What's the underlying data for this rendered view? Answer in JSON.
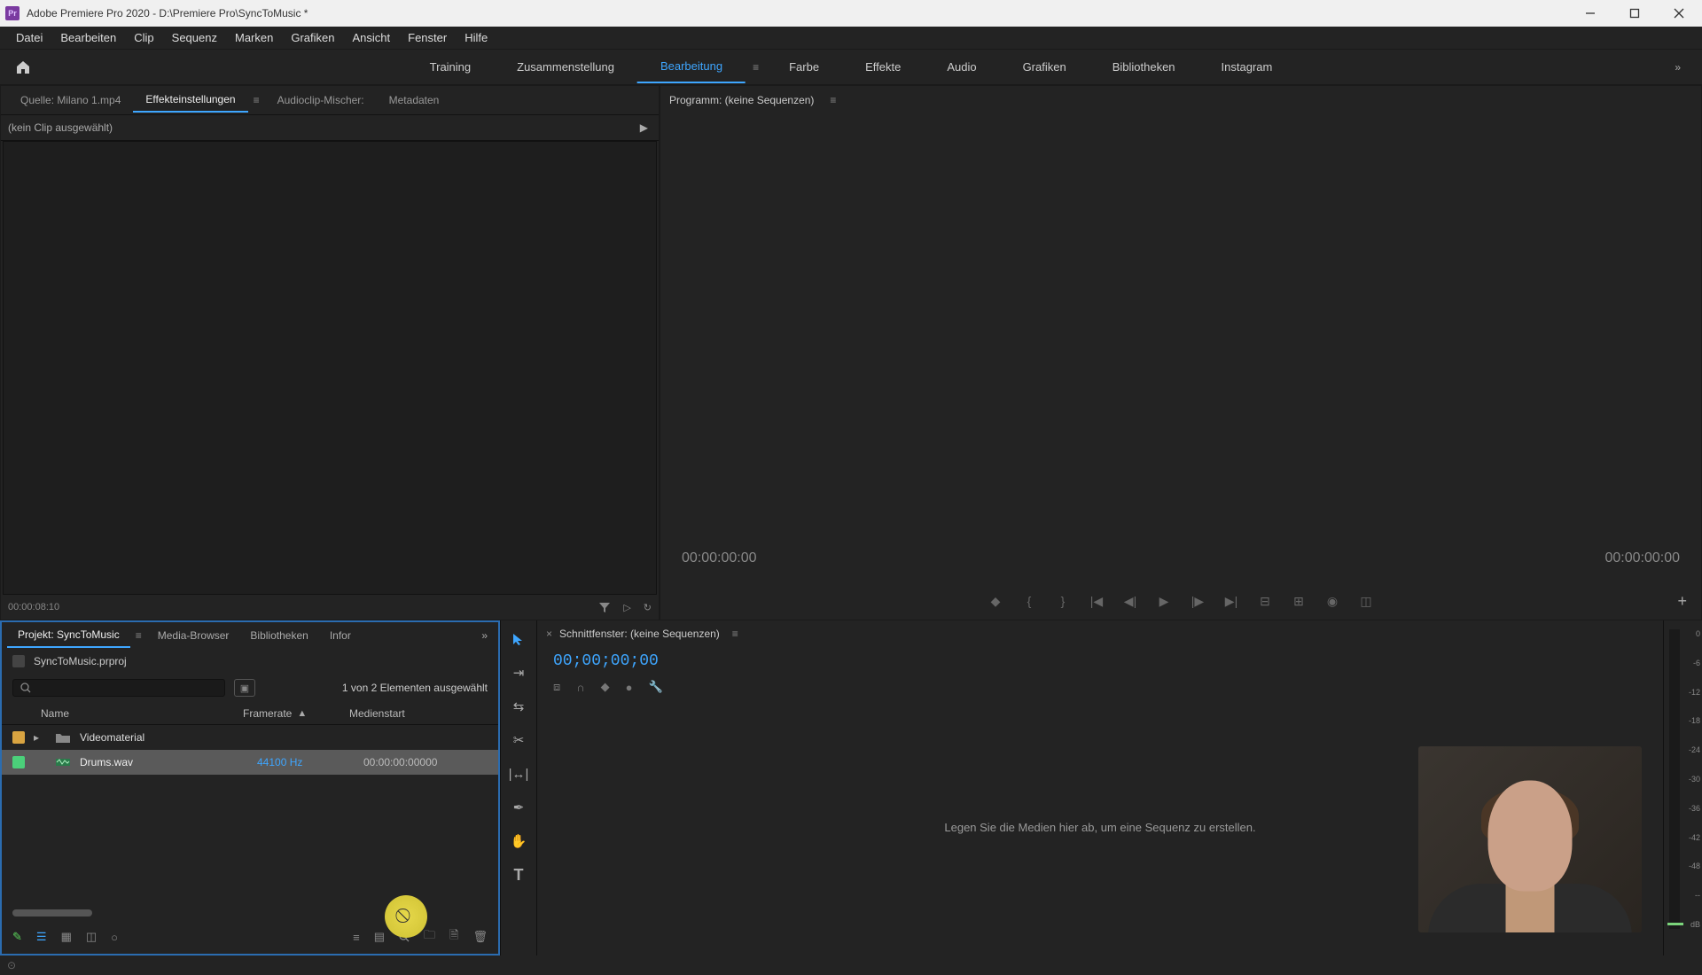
{
  "titlebar": {
    "app_name": "Adobe Premiere Pro 2020",
    "project_path": "D:\\Premiere Pro\\SyncToMusic *",
    "full_title": "Adobe Premiere Pro 2020 - D:\\Premiere Pro\\SyncToMusic *"
  },
  "menubar": [
    "Datei",
    "Bearbeiten",
    "Clip",
    "Sequenz",
    "Marken",
    "Grafiken",
    "Ansicht",
    "Fenster",
    "Hilfe"
  ],
  "workspaces": {
    "items": [
      "Training",
      "Zusammenstellung",
      "Bearbeitung",
      "Farbe",
      "Effekte",
      "Audio",
      "Grafiken",
      "Bibliotheken",
      "Instagram"
    ],
    "active_index": 2
  },
  "source_panel": {
    "tabs": [
      "Quelle: Milano 1.mp4",
      "Effekteinstellungen",
      "Audioclip-Mischer:",
      "Metadaten"
    ],
    "active_tab_index": 1,
    "no_clip_text": "(kein Clip ausgewählt)",
    "footer_time": "00:00:08:10"
  },
  "program_panel": {
    "title": "Programm: (keine Sequenzen)",
    "time_left": "00:00:00:00",
    "time_right": "00:00:00:00"
  },
  "project_panel": {
    "tabs": [
      "Projekt: SyncToMusic",
      "Media-Browser",
      "Bibliotheken",
      "Infor"
    ],
    "active_tab_index": 0,
    "filename": "SyncToMusic.prproj",
    "selection_text": "1 von 2 Elementen ausgewählt",
    "columns": {
      "name": "Name",
      "framerate": "Framerate",
      "medienstart": "Medienstart"
    },
    "rows": [
      {
        "tag_color": "#d9a441",
        "expandable": true,
        "type": "folder",
        "name": "Videomaterial",
        "framerate": "",
        "medienstart": "",
        "selected": false
      },
      {
        "tag_color": "#4bd07a",
        "expandable": false,
        "type": "audio",
        "name": "Drums.wav",
        "framerate": "44100  Hz",
        "medienstart": "00:00:00:00000",
        "selected": true
      }
    ]
  },
  "timeline_panel": {
    "title": "Schnittfenster: (keine Sequenzen)",
    "timecode": "00;00;00;00",
    "empty_text": "Legen Sie die Medien hier ab, um eine Sequenz zu erstellen."
  },
  "meters": {
    "db_labels": [
      "0",
      "-6",
      "-12",
      "-18",
      "-24",
      "-30",
      "-36",
      "-42",
      "-48",
      "--",
      "dB"
    ]
  },
  "transport_icons": [
    "marker-icon",
    "in-bracket-icon",
    "out-bracket-icon",
    "goto-in-icon",
    "step-back-icon",
    "play-icon",
    "step-forward-icon",
    "goto-out-icon",
    "lift-icon",
    "extract-icon",
    "export-frame-icon",
    "comparison-icon"
  ],
  "tools": [
    "selection-tool",
    "track-select-tool",
    "ripple-edit-tool",
    "razor-tool",
    "slip-tool",
    "pen-tool",
    "hand-tool",
    "type-tool"
  ],
  "proj_footer_icons_left": [
    "pen-icon",
    "list-view-icon",
    "icon-view-icon",
    "freeform-icon",
    "zoom-slider-icon"
  ],
  "proj_footer_icons_right": [
    "sort-icon",
    "automate-icon",
    "find-icon",
    "new-bin-icon",
    "new-item-icon",
    "clear-icon"
  ]
}
